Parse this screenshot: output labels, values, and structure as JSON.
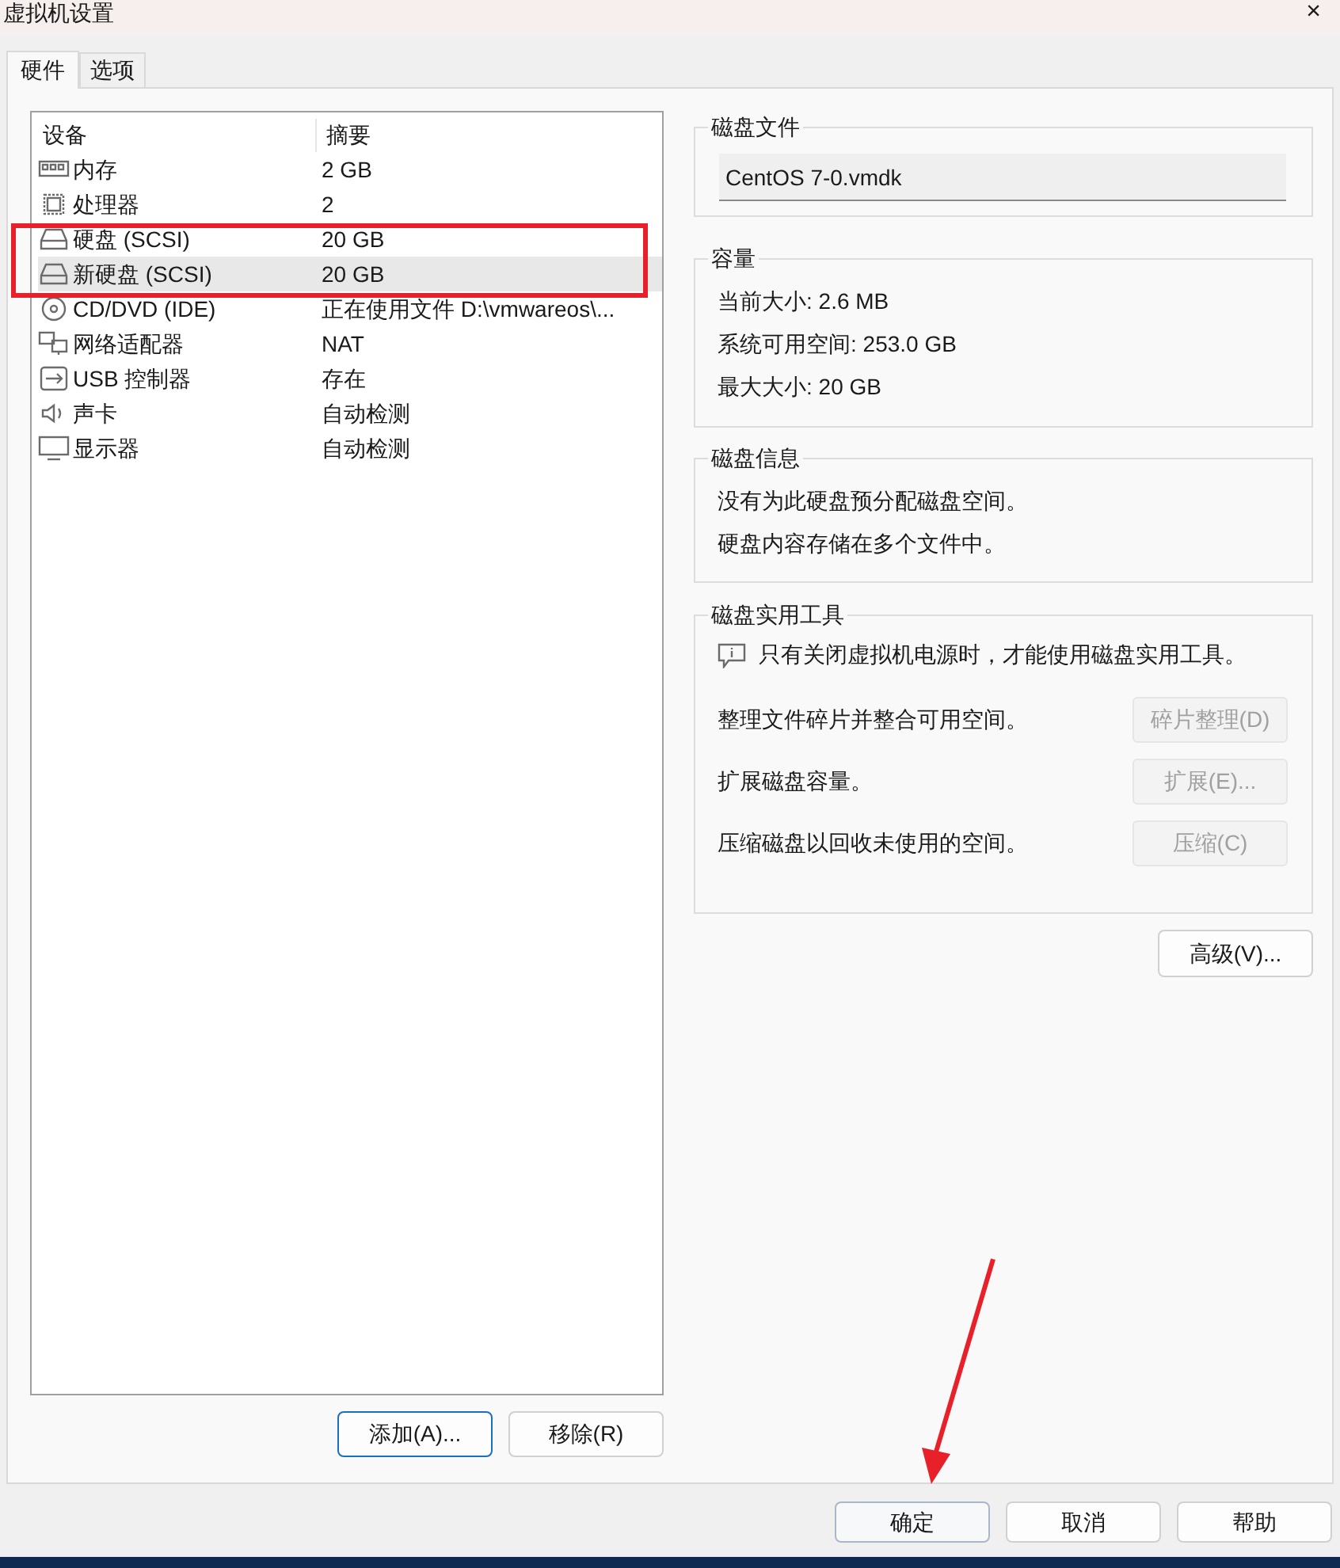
{
  "window": {
    "title": "虚拟机设置",
    "close": "×"
  },
  "tabs": [
    {
      "label": "硬件",
      "selected": true
    },
    {
      "label": "选项",
      "selected": false
    }
  ],
  "device_table": {
    "columns": [
      "设备",
      "摘要"
    ],
    "rows": [
      {
        "kind": "memory",
        "device": "内存",
        "summary": "2 GB",
        "selected": false
      },
      {
        "kind": "cpu",
        "device": "处理器",
        "summary": "2",
        "selected": false
      },
      {
        "kind": "disk",
        "device": "硬盘 (SCSI)",
        "summary": "20 GB",
        "selected": false
      },
      {
        "kind": "disk",
        "device": "新硬盘 (SCSI)",
        "summary": "20 GB",
        "selected": true
      },
      {
        "kind": "cd",
        "device": "CD/DVD (IDE)",
        "summary": "正在使用文件 D:\\vmwareos\\...",
        "selected": false
      },
      {
        "kind": "network",
        "device": "网络适配器",
        "summary": "NAT",
        "selected": false
      },
      {
        "kind": "usb",
        "device": "USB 控制器",
        "summary": "存在",
        "selected": false
      },
      {
        "kind": "sound",
        "device": "声卡",
        "summary": "自动检测",
        "selected": false
      },
      {
        "kind": "display",
        "device": "显示器",
        "summary": "自动检测",
        "selected": false
      }
    ]
  },
  "list_buttons": [
    {
      "label": "添加(A)...",
      "focused": true
    },
    {
      "label": "移除(R)",
      "focused": false
    }
  ],
  "disk_file": {
    "title": "磁盘文件",
    "value": "CentOS 7-0.vmdk"
  },
  "capacity": {
    "title": "容量",
    "lines": [
      "当前大小: 2.6 MB",
      "系统可用空间: 253.0 GB",
      "最大大小: 20 GB"
    ]
  },
  "disk_info": {
    "title": "磁盘信息",
    "lines": [
      "没有为此硬盘预分配磁盘空间。",
      "硬盘内容存储在多个文件中。"
    ]
  },
  "disk_utilities": {
    "title": "磁盘实用工具",
    "note": "只有关闭虚拟机电源时，才能使用磁盘实用工具。",
    "actions": [
      {
        "description": "整理文件碎片并整合可用空间。",
        "button": "碎片整理(D)",
        "disabled": true
      },
      {
        "description": "扩展磁盘容量。",
        "button": "扩展(E)...",
        "disabled": true
      },
      {
        "description": "压缩磁盘以回收未使用的空间。",
        "button": "压缩(C)",
        "disabled": true
      }
    ]
  },
  "advanced_button": "高级(V)...",
  "dialog_buttons": [
    {
      "label": "确定",
      "focused": true
    },
    {
      "label": "取消",
      "focused": false
    },
    {
      "label": "帮助",
      "focused": false
    }
  ]
}
